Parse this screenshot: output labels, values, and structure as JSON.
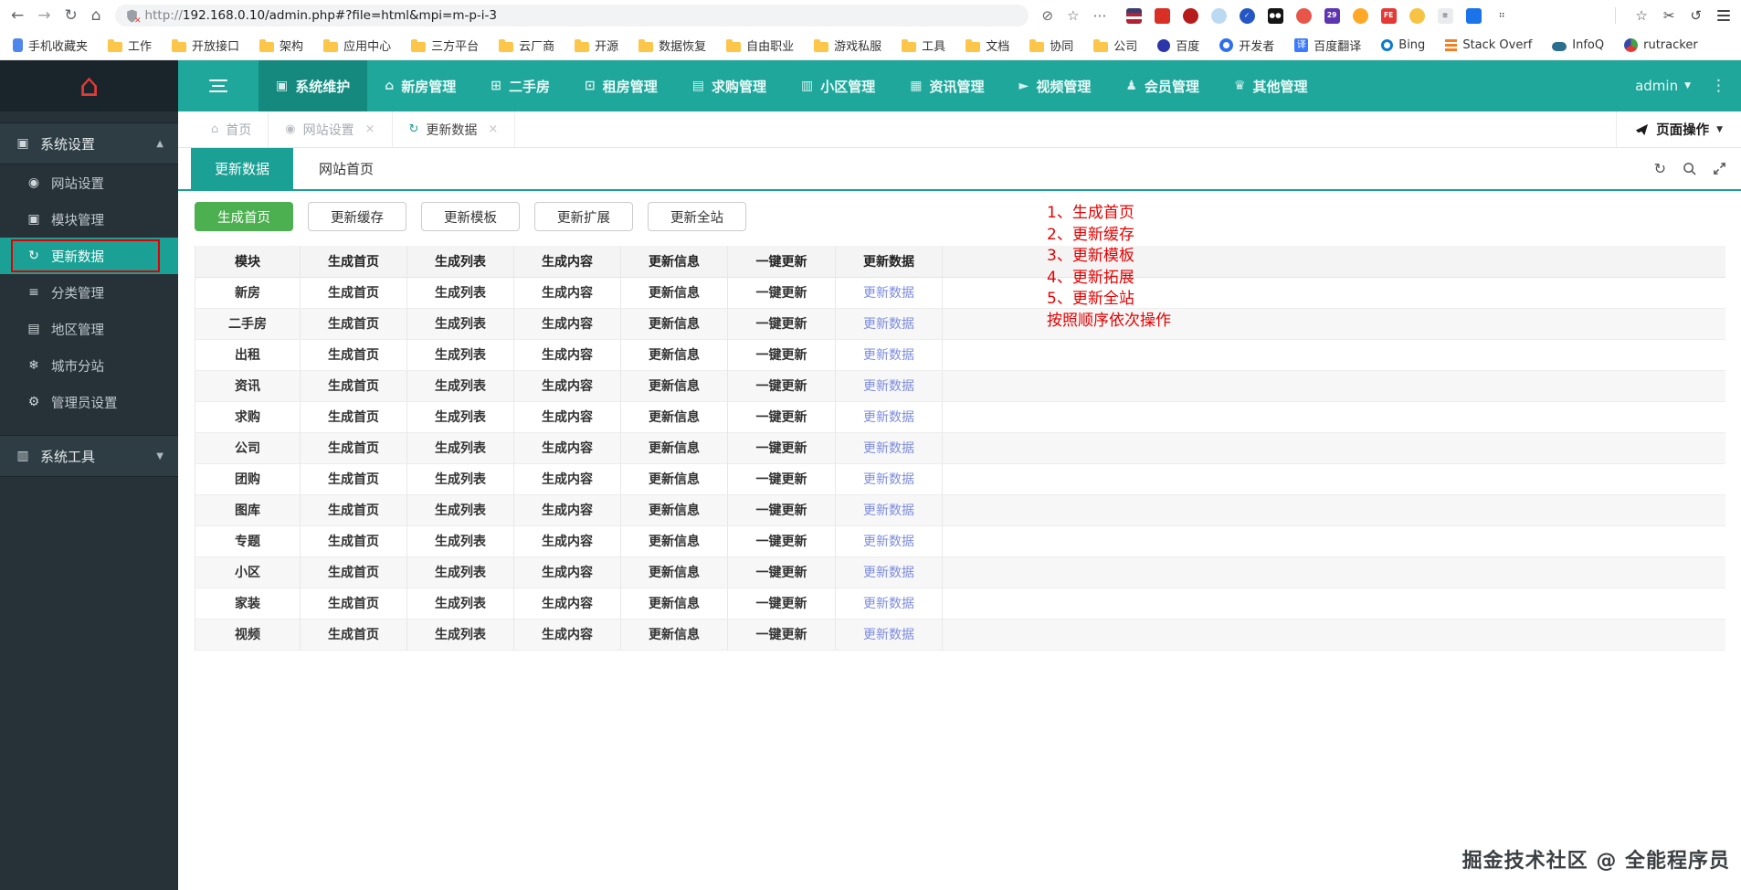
{
  "colors": {
    "teal": "#1aa094",
    "teal_nav": "#1fa79b",
    "teal_dark": "#15897e",
    "sidebar_bg": "#263238",
    "green_button": "#4cb050",
    "note_red": "#e60000",
    "link_blue": "#7d8ce0"
  },
  "browser": {
    "url_scheme": "http://",
    "url_rest": "192.168.0.10/admin.php#?file=html&mpi=m-p-i-3",
    "bookmarks": [
      {
        "label": "手机收藏夹",
        "icon": "phone"
      },
      {
        "label": "工作",
        "icon": "folder"
      },
      {
        "label": "开放接口",
        "icon": "folder"
      },
      {
        "label": "架构",
        "icon": "folder"
      },
      {
        "label": "应用中心",
        "icon": "folder"
      },
      {
        "label": "三方平台",
        "icon": "folder"
      },
      {
        "label": "云厂商",
        "icon": "folder"
      },
      {
        "label": "开源",
        "icon": "folder"
      },
      {
        "label": "数据恢复",
        "icon": "folder"
      },
      {
        "label": "自由职业",
        "icon": "folder"
      },
      {
        "label": "游戏私服",
        "icon": "folder"
      },
      {
        "label": "工具",
        "icon": "folder"
      },
      {
        "label": "文档",
        "icon": "folder"
      },
      {
        "label": "协同",
        "icon": "folder"
      },
      {
        "label": "公司",
        "icon": "folder"
      },
      {
        "label": "百度",
        "icon": "baidu"
      },
      {
        "label": "开发者",
        "icon": "dev"
      },
      {
        "label": "百度翻译",
        "icon": "fanyi",
        "glyph": "译"
      },
      {
        "label": "Bing",
        "icon": "bing"
      },
      {
        "label": "Stack Overf",
        "icon": "stack"
      },
      {
        "label": "InfoQ",
        "icon": "infoq"
      },
      {
        "label": "rutracker",
        "icon": "rutracker"
      }
    ],
    "extensions": [
      {
        "name": "flag-extension-icon",
        "shape": "square",
        "bg": "linear-gradient(180deg,#3c3b6e 0 30%,#b22234 30% 53%,#ffffff 53% 70%,#b22234 70% 100%)"
      },
      {
        "name": "pin-extension-icon",
        "shape": "square",
        "bg": "#d93025"
      },
      {
        "name": "stop-extension-icon",
        "shape": "circle",
        "bg": "#b71c1c"
      },
      {
        "name": "pale-extension-icon",
        "shape": "circle",
        "bg": "#bcd9f2"
      },
      {
        "name": "check-extension-icon",
        "shape": "circle",
        "bg": "#2456c4",
        "glyph": "✓",
        "fg": "#ffffff"
      },
      {
        "name": "dots-extension-icon",
        "shape": "square",
        "bg": "#141414",
        "glyph": "●●",
        "fg": "#ffffff"
      },
      {
        "name": "person-extension-icon",
        "shape": "circle",
        "bg": "#e8564a"
      },
      {
        "name": "calendar-29-extension-icon",
        "shape": "square",
        "bg": "#5e35b1",
        "glyph": "29",
        "fg": "#ffffff"
      },
      {
        "name": "crescent-extension-icon",
        "shape": "circle",
        "bg": "#ffa726"
      },
      {
        "name": "fe-extension-icon",
        "shape": "square",
        "bg": "#e53935",
        "glyph": "FE",
        "fg": "#ffffff"
      },
      {
        "name": "shield-extension-icon",
        "shape": "circle",
        "bg": "#f6c344"
      },
      {
        "name": "doc-extension-icon",
        "shape": "square",
        "bg": "#e9ebee",
        "glyph": "≡",
        "fg": "#5f6368"
      },
      {
        "name": "person-blue-extension-icon",
        "shape": "square",
        "bg": "#1a73e8"
      },
      {
        "name": "grid-extension-icon",
        "shape": "square",
        "bg": "#ffffff",
        "glyph": "∷",
        "fg": "#111111"
      }
    ]
  },
  "navbar": {
    "items": [
      {
        "label": "系统维护",
        "name": "system-maintenance",
        "glyph": "▣",
        "active": true
      },
      {
        "label": "新房管理",
        "name": "new-house-management",
        "glyph": "⌂"
      },
      {
        "label": "二手房",
        "name": "second-hand-house",
        "glyph": "⊞"
      },
      {
        "label": "租房管理",
        "name": "rental-management",
        "glyph": "⊡"
      },
      {
        "label": "求购管理",
        "name": "purchase-management",
        "glyph": "▤"
      },
      {
        "label": "小区管理",
        "name": "community-management",
        "glyph": "▥"
      },
      {
        "label": "资讯管理",
        "name": "news-management",
        "glyph": "▦"
      },
      {
        "label": "视频管理",
        "name": "video-management",
        "glyph": "►"
      },
      {
        "label": "会员管理",
        "name": "member-management",
        "glyph": "♟"
      },
      {
        "label": "其他管理",
        "name": "other-management",
        "glyph": "♛"
      }
    ],
    "user": "admin"
  },
  "sidebar": {
    "section1": {
      "label": "系统设置",
      "glyph": "▣",
      "arrow": "▲"
    },
    "items": [
      {
        "label": "网站设置",
        "name": "website-settings",
        "glyph": "◉"
      },
      {
        "label": "模块管理",
        "name": "module-management",
        "glyph": "▣"
      },
      {
        "label": "更新数据",
        "name": "update-data",
        "glyph": "↻",
        "active": true
      },
      {
        "label": "分类管理",
        "name": "category-management",
        "glyph": "≡"
      },
      {
        "label": "地区管理",
        "name": "region-management",
        "glyph": "▤"
      },
      {
        "label": "城市分站",
        "name": "city-substation",
        "glyph": "❄"
      },
      {
        "label": "管理员设置",
        "name": "administrator-settings",
        "glyph": "⚙"
      }
    ],
    "section2": {
      "label": "系统工具",
      "glyph": "▥",
      "arrow": "▼"
    }
  },
  "tabbar": {
    "tabs": [
      {
        "label": "首页",
        "name": "home",
        "glyph": "⌂",
        "closable": false
      },
      {
        "label": "网站设置",
        "name": "website-settings",
        "glyph": "◉",
        "closable": true
      },
      {
        "label": "更新数据",
        "name": "update-data",
        "glyph": "↻",
        "closable": true,
        "active": true
      }
    ],
    "page_ops": "页面操作"
  },
  "subbar": {
    "active_tab": "更新数据",
    "page_label": "网站首页"
  },
  "toolbar": {
    "buttons": [
      {
        "label": "生成首页",
        "name": "generate-homepage",
        "primary": true
      },
      {
        "label": "更新缓存",
        "name": "update-cache"
      },
      {
        "label": "更新模板",
        "name": "update-template"
      },
      {
        "label": "更新扩展",
        "name": "update-extension"
      },
      {
        "label": "更新全站",
        "name": "update-whole-site"
      }
    ]
  },
  "table": {
    "headers": [
      "模块",
      "生成首页",
      "生成列表",
      "生成内容",
      "更新信息",
      "一键更新",
      "更新数据"
    ],
    "modules": [
      "新房",
      "二手房",
      "出租",
      "资讯",
      "求购",
      "公司",
      "团购",
      "图库",
      "专题",
      "小区",
      "家装",
      "视频"
    ],
    "row_actions": [
      "生成首页",
      "生成列表",
      "生成内容",
      "更新信息",
      "一键更新"
    ],
    "row_action_names": [
      "generate-homepage",
      "generate-list",
      "generate-content",
      "update-info",
      "one-key-update"
    ],
    "update_link": "更新数据"
  },
  "notes": {
    "lines": [
      "1、生成首页",
      "2、更新缓存",
      "3、更新模板",
      "4、更新拓展",
      "5、更新全站",
      "按照顺序依次操作"
    ]
  },
  "watermark": "掘金技术社区 @ 全能程序员"
}
